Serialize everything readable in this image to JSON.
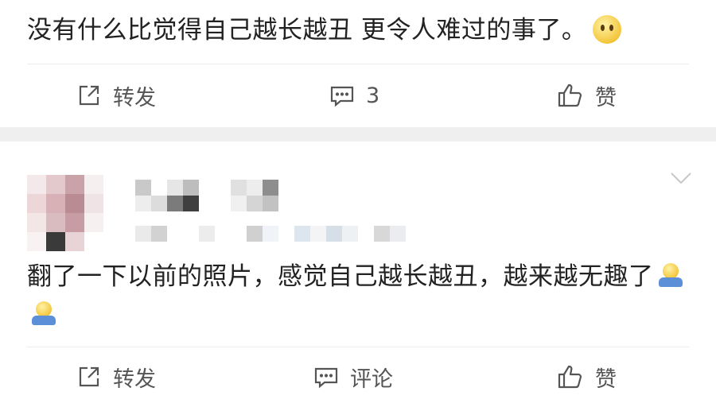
{
  "post_top": {
    "text": "没有什么比觉得自己越长越丑 更令人难过的事了。",
    "emoji": "smirk-face-emoji",
    "actions": {
      "repost_label": "转发",
      "comment_label": "3",
      "like_label": "赞"
    }
  },
  "comment_post": {
    "author_name_hidden": "pixelated",
    "text": "翻了一下以前的照片，感觉自己越长越丑，越来越无趣了",
    "emojis": [
      "shrug-emoji",
      "shrug-emoji"
    ],
    "actions": {
      "repost_label": "转发",
      "comment_label": "评论",
      "like_label": "赞"
    }
  },
  "icons": {
    "repost": "repost-icon",
    "comment": "comment-icon",
    "like": "thumbs-up-icon",
    "more": "chevron-down-icon"
  },
  "colors": {
    "text": "#222222",
    "action_text": "#555555",
    "separator": "#efefef"
  }
}
